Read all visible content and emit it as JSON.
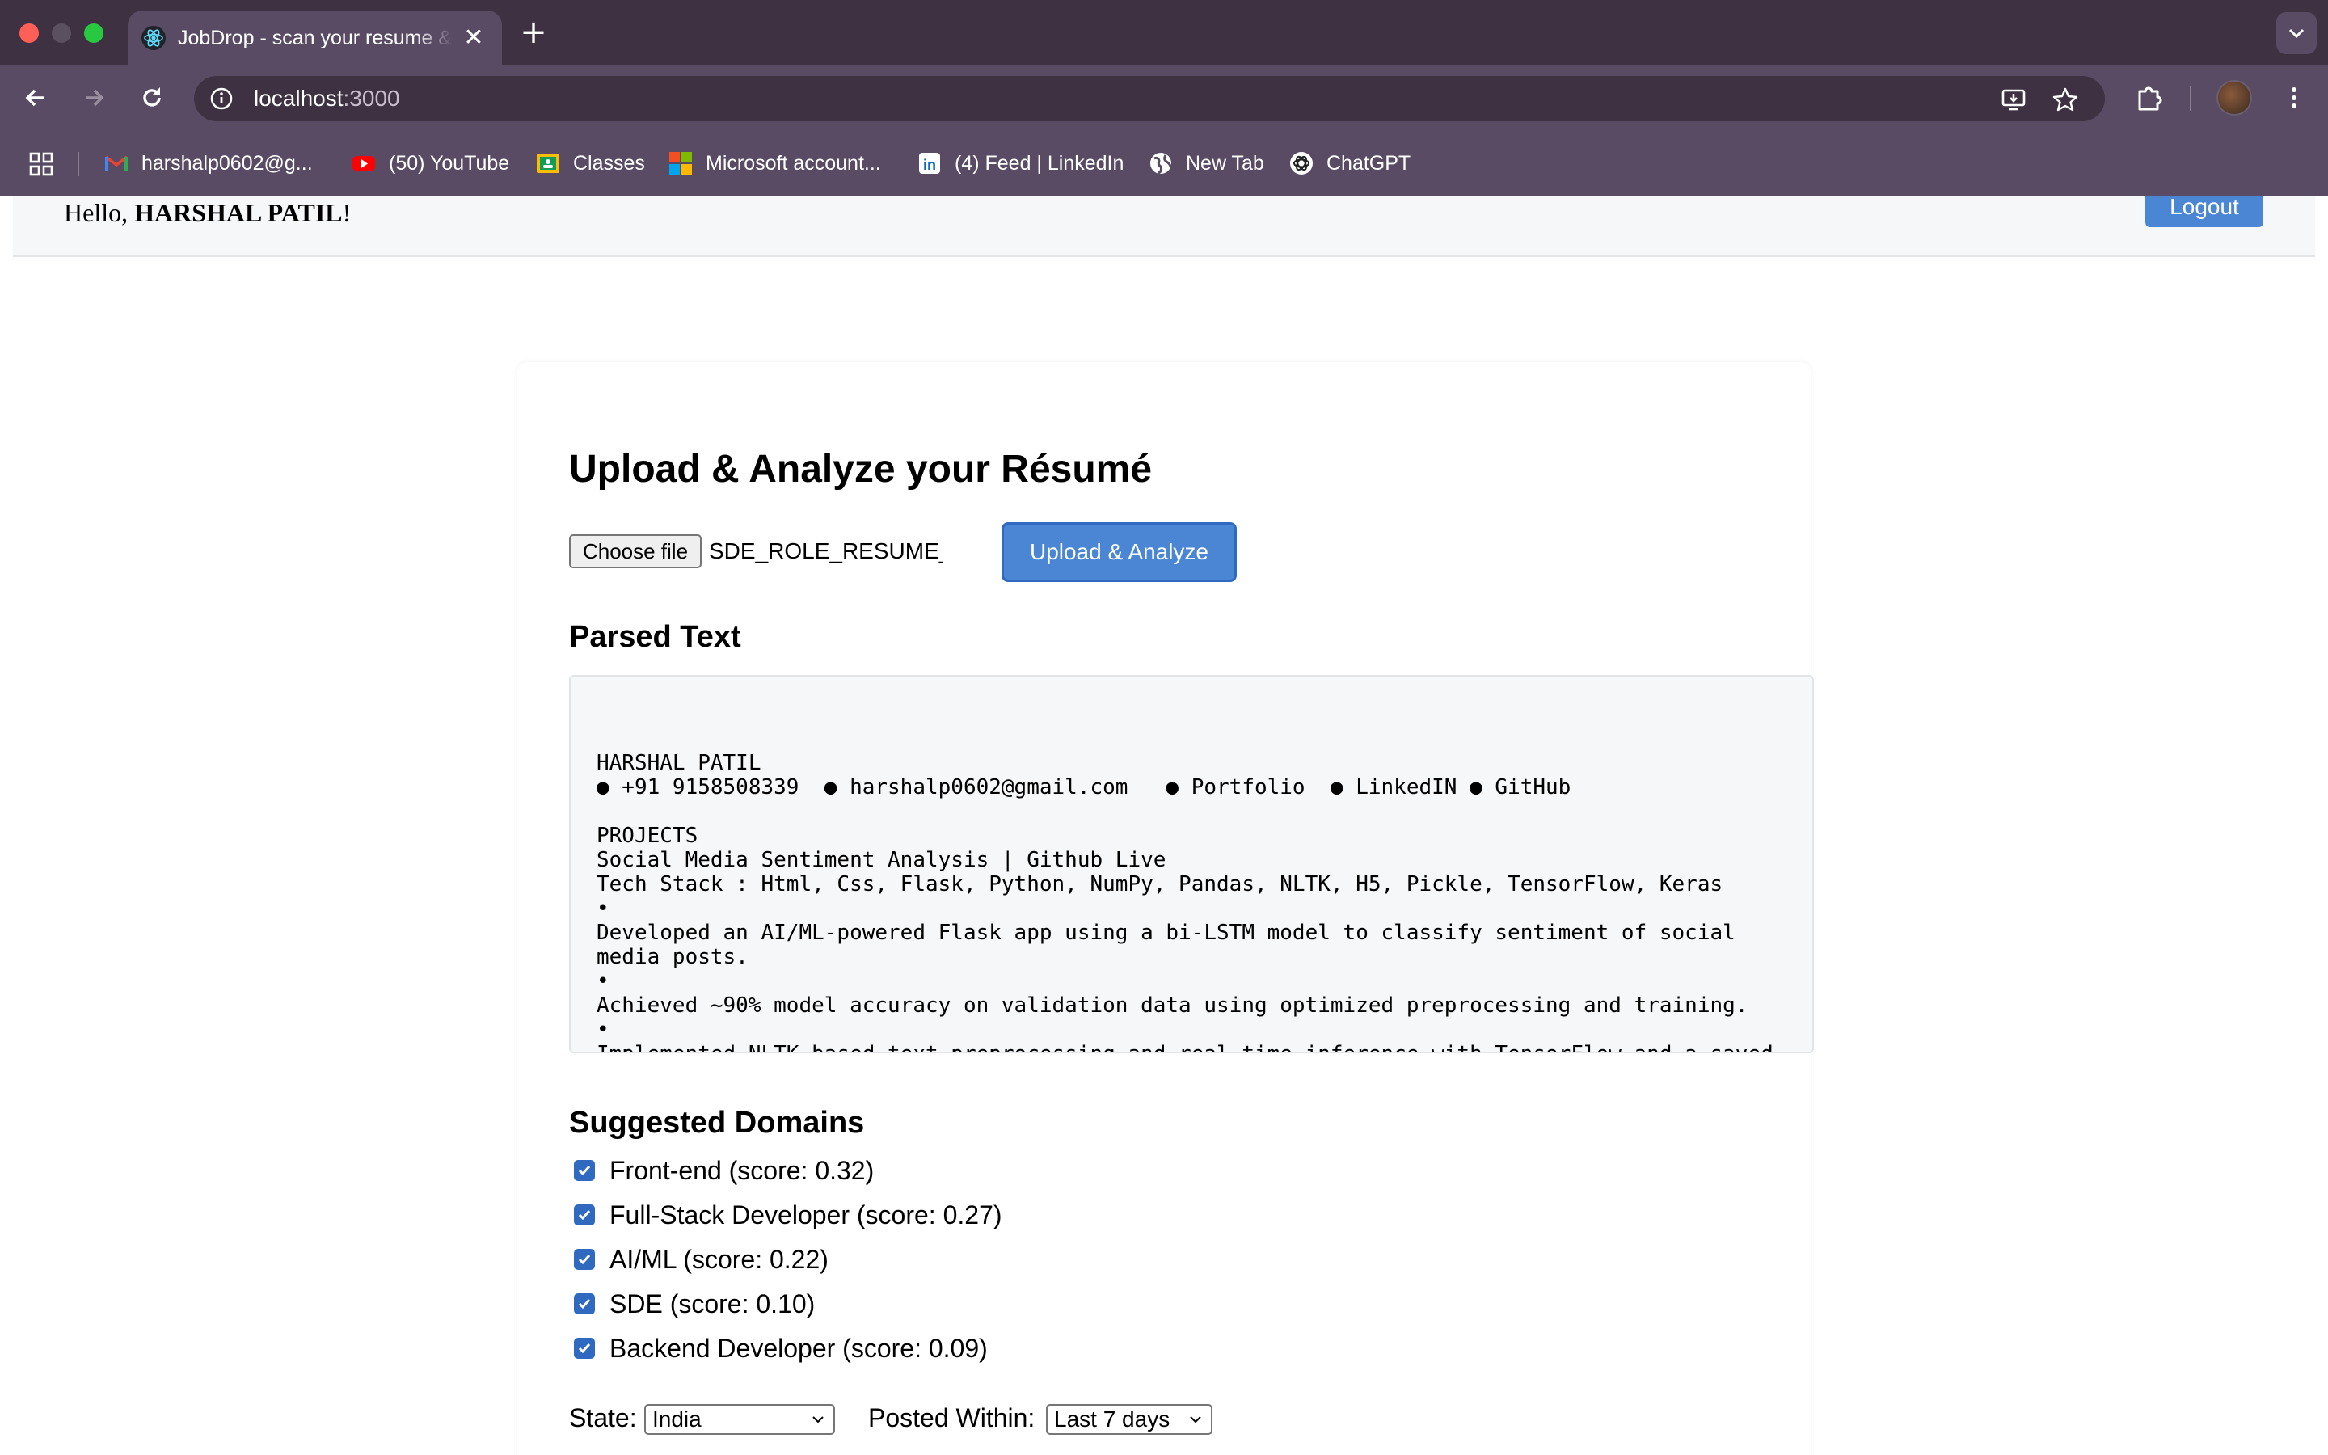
{
  "browser": {
    "tab_title": "JobDrop - scan your resume & get job",
    "url_host": "localhost",
    "url_port": ":3000",
    "bookmarks": [
      {
        "label": "harshalp0602@g...",
        "icon": "gmail-icon"
      },
      {
        "label": "(50) YouTube",
        "icon": "youtube-icon"
      },
      {
        "label": "Classes",
        "icon": "classroom-icon"
      },
      {
        "label": "Microsoft account...",
        "icon": "microsoft-icon"
      },
      {
        "label": "(4) Feed | LinkedIn",
        "icon": "linkedin-icon"
      },
      {
        "label": "New Tab",
        "icon": "globe-icon"
      },
      {
        "label": "ChatGPT",
        "icon": "chatgpt-icon"
      }
    ]
  },
  "header": {
    "greeting_prefix": "Hello, ",
    "user_name": "HARSHAL PATIL",
    "greeting_suffix": "!",
    "logout_label": "Logout"
  },
  "upload": {
    "title": "Upload & Analyze your Résumé",
    "choose_file_label": "Choose file",
    "file_name": "SDE_ROLE_RESUME_",
    "upload_button_label": "Upload & Analyze"
  },
  "parsed": {
    "heading": "Parsed Text",
    "text": "HARSHAL PATIL\n● +91 9158508339  ● harshalp0602@gmail.com   ● Portfolio  ● LinkedIN ● GitHub\n\nPROJECTS\nSocial Media Sentiment Analysis | Github Live\nTech Stack : Html, Css, Flask, Python, NumPy, Pandas, NLTK, H5, Pickle, TensorFlow, Keras\n•\nDeveloped an AI/ML-powered Flask app using a bi-LSTM model to classify sentiment of social\nmedia posts.\n•\nAchieved ~90% model accuracy on validation data using optimized preprocessing and training.\n•\nImplemented NLTK-based text preprocessing and real-time inference with TensorFlow and a saved"
  },
  "domains": {
    "heading": "Suggested Domains",
    "items": [
      {
        "label": "Front-end (score: 0.32)",
        "checked": true
      },
      {
        "label": "Full-Stack Developer (score: 0.27)",
        "checked": true
      },
      {
        "label": "AI/ML (score: 0.22)",
        "checked": true
      },
      {
        "label": "SDE (score: 0.10)",
        "checked": true
      },
      {
        "label": "Backend Developer (score: 0.09)",
        "checked": true
      }
    ]
  },
  "filters": {
    "state_label": "State:",
    "state_value": "India",
    "posted_label": "Posted Within:",
    "posted_value": "Last 7 days"
  },
  "colors": {
    "chrome_dark": "#3d3142",
    "chrome_mid": "#594b63",
    "accent_blue": "#4a86d4",
    "checkbox_blue": "#2f6ac0"
  }
}
